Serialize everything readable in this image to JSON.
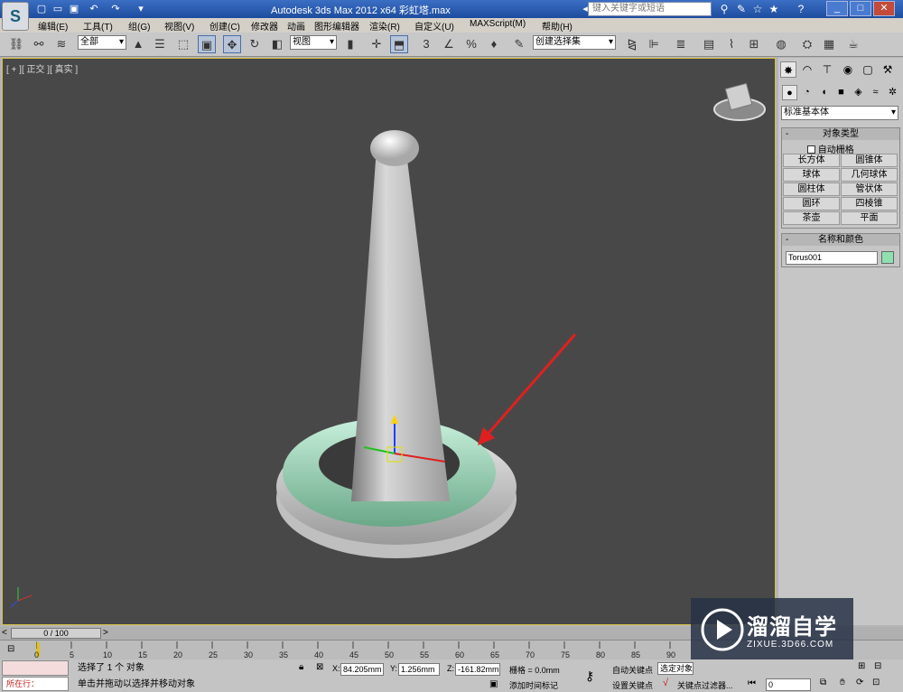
{
  "titlebar": {
    "title": "Autodesk 3ds Max  2012 x64    彩虹塔.max",
    "search_placeholder": "键入关键字或短语"
  },
  "menu": [
    "编辑(E)",
    "工具(T)",
    "组(G)",
    "视图(V)",
    "创建(C)",
    "修改器",
    "动画",
    "图形编辑器",
    "渲染(R)",
    "自定义(U)",
    "MAXScript(M)",
    "帮助(H)"
  ],
  "toolbar": {
    "selection_filter": "全部",
    "ref_coord": "视图",
    "named_selection": "创建选择集"
  },
  "viewport": {
    "label": "[ + ][ 正交 ][ 真实 ]"
  },
  "command_panel": {
    "category": "标准基本体",
    "object_type_title": "对象类型",
    "auto_grid": "自动栅格",
    "buttons": [
      "长方体",
      "圆锥体",
      "球体",
      "几何球体",
      "圆柱体",
      "管状体",
      "圆环",
      "四棱锥",
      "茶壶",
      "平面"
    ],
    "name_color_title": "名称和颜色",
    "object_name": "Torus001",
    "object_color": "#8fe0b0"
  },
  "timeline": {
    "slider": "0 / 100",
    "ticks": [
      "0",
      "5",
      "10",
      "15",
      "20",
      "25",
      "30",
      "35",
      "40",
      "45",
      "50",
      "55",
      "60",
      "65",
      "70",
      "75",
      "80",
      "85",
      "90"
    ]
  },
  "status": {
    "maxscript": "所在行：",
    "selected": "选择了 1 个 对象",
    "prompt": "单击并拖动以选择并移动对象",
    "x_label": "X:",
    "x": "84.205mm",
    "y_label": "Y:",
    "y": "1.256mm",
    "z_label": "Z:",
    "z": "-161.82mm",
    "grid": "栅格 = 0.0mm",
    "add_time_tag": "添加时间标记",
    "auto_key": "自动关键点",
    "set_key": "设置关键点",
    "selected_object": "选定对象",
    "key_filters": "关键点过滤器...",
    "frame": "0"
  },
  "watermark": {
    "brand": "溜溜自学",
    "url": "ZIXUE.3D66.COM"
  }
}
